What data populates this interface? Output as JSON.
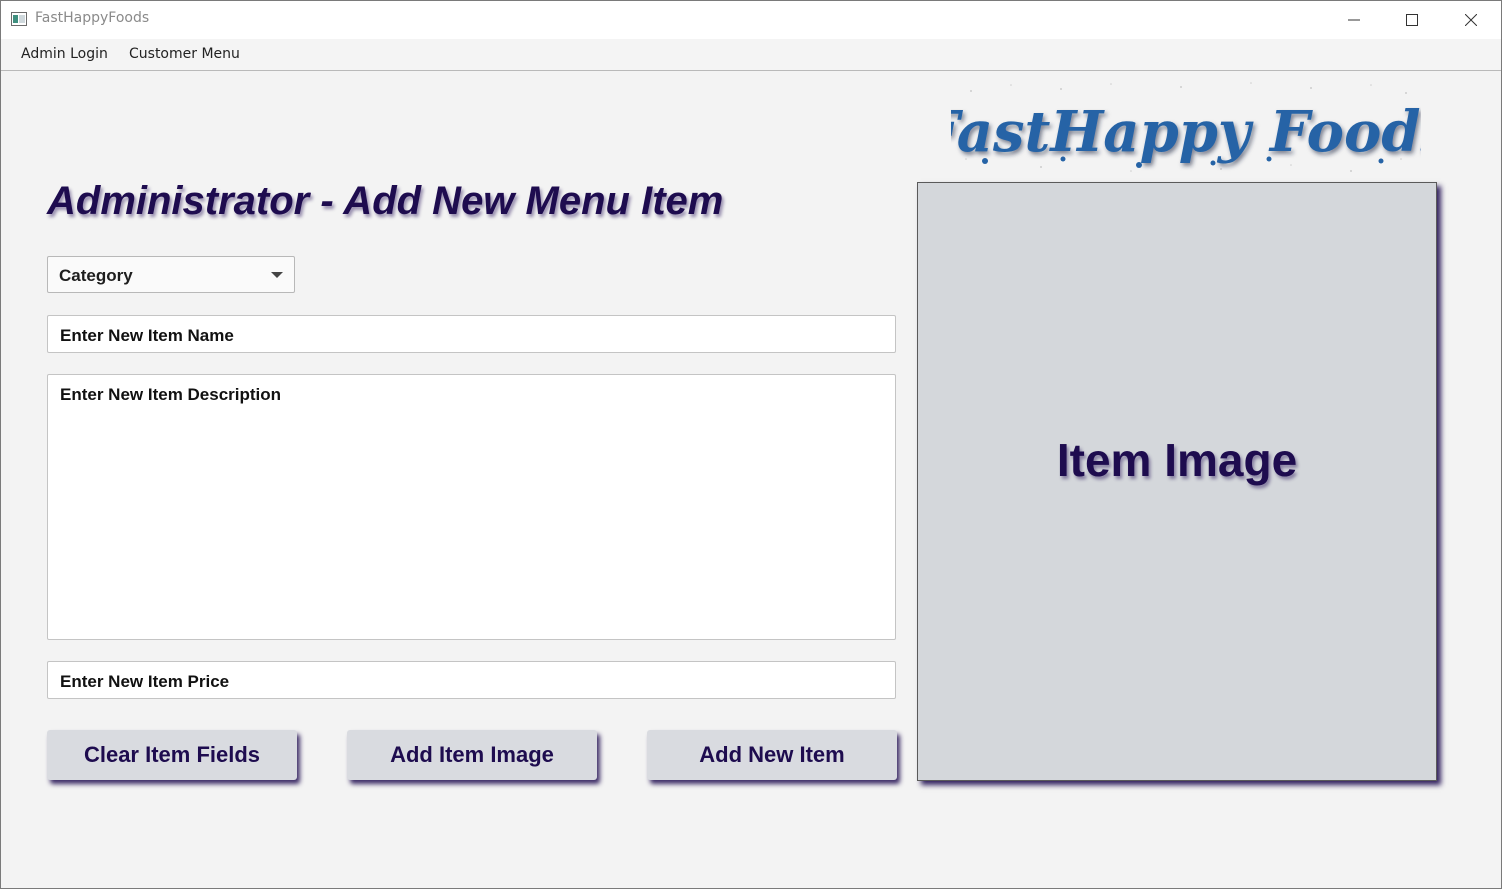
{
  "window": {
    "title": "FastHappyFoods"
  },
  "menu": {
    "items": [
      "Admin Login",
      "Customer Menu"
    ]
  },
  "brand": {
    "logo_text": "FastHappy Foods",
    "logo_color": "#2563a6"
  },
  "form": {
    "heading": "Administrator - Add New Menu Item",
    "category_value": "Category",
    "name_value": "Enter New Item Name",
    "description_value": "Enter New Item Description",
    "price_value": "Enter New Item Price"
  },
  "buttons": {
    "clear": "Clear Item Fields",
    "add_image": "Add Item Image",
    "add_item": "Add New Item"
  },
  "image_panel": {
    "label": "Item Image"
  },
  "colors": {
    "accent": "#1e0c4f",
    "panel_bg": "#d4d7db",
    "button_bg": "#d9dbe0"
  },
  "icons": [
    "app-icon",
    "minimize-icon",
    "maximize-icon",
    "close-icon",
    "chevron-down-icon"
  ]
}
